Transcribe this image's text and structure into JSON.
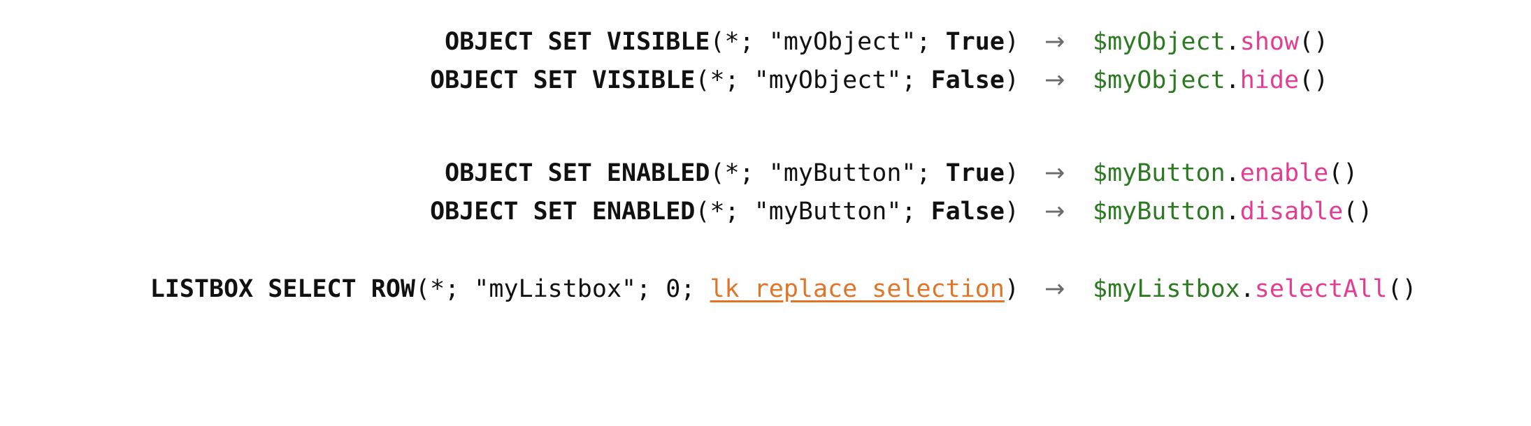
{
  "arrow_glyph": "→",
  "colors": {
    "keyword": "#111111",
    "arrow": "#6b6b6b",
    "variable": "#2b7a22",
    "method": "#e23d92",
    "constant": "#e0752a"
  },
  "rows": [
    {
      "command": "OBJECT SET VISIBLE",
      "open": "(",
      "star": "*",
      "sep1": "; ",
      "target": "\"myObject\"",
      "sep2": "; ",
      "arg": "True",
      "close": ")",
      "variable": "$myObject",
      "dot": ".",
      "method": "show",
      "parens": "()"
    },
    {
      "command": "OBJECT SET VISIBLE",
      "open": "(",
      "star": "*",
      "sep1": "; ",
      "target": "\"myObject\"",
      "sep2": "; ",
      "arg": "False",
      "close": ")",
      "variable": "$myObject",
      "dot": ".",
      "method": "hide",
      "parens": "()"
    },
    {
      "command": "OBJECT SET ENABLED",
      "open": "(",
      "star": "*",
      "sep1": "; ",
      "target": "\"myButton\"",
      "sep2": "; ",
      "arg": "True",
      "close": ")",
      "variable": "$myButton",
      "dot": ".",
      "method": "enable",
      "parens": "()"
    },
    {
      "command": "OBJECT SET ENABLED",
      "open": "(",
      "star": "*",
      "sep1": "; ",
      "target": "\"myButton\"",
      "sep2": "; ",
      "arg": "False",
      "close": ")",
      "variable": "$myButton",
      "dot": ".",
      "method": "disable",
      "parens": "()"
    },
    {
      "command": "LISTBOX SELECT ROW",
      "open": "(",
      "star": "*",
      "sep1": "; ",
      "target": "\"myListbox\"",
      "sep2": "; ",
      "number": "0",
      "sep3": "; ",
      "constant": "lk replace selection",
      "close": ")",
      "variable": "$myListbox",
      "dot": ".",
      "method": "selectAll",
      "parens": "()"
    }
  ]
}
